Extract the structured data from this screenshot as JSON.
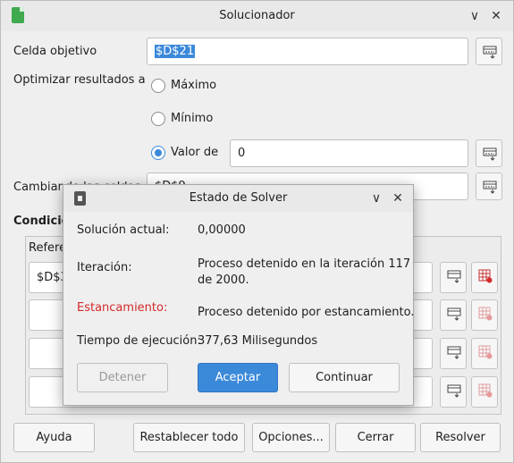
{
  "main_window": {
    "title": "Solucionador",
    "controls": {
      "minimize": "∨",
      "close": "✕"
    },
    "target_cell": {
      "label": "Celda objetivo",
      "value": "$D$21"
    },
    "optimize": {
      "label": "Optimizar resultados a",
      "options": [
        "Máximo",
        "Mínimo",
        "Valor de"
      ],
      "selected": "Valor de",
      "value_of": "0"
    },
    "changing_cells": {
      "label": "Cambiando las celdas",
      "value": "$D$9"
    },
    "conditions": {
      "label": "Condiciones",
      "ref_header": "Referencia de celda",
      "rows": [
        {
          "ref": "$D$3"
        },
        {
          "ref": ""
        },
        {
          "ref": ""
        },
        {
          "ref": ""
        }
      ]
    },
    "buttons": {
      "help": "Ayuda",
      "reset_all": "Restablecer todo",
      "options": "Opciones...",
      "close": "Cerrar",
      "solve": "Resolver"
    }
  },
  "status_dialog": {
    "title": "Estado de Solver",
    "controls": {
      "minimize": "∨",
      "close": "✕"
    },
    "current_solution": {
      "label": "Solución actual:",
      "value": "0,00000"
    },
    "iteration": {
      "label": "Iteración:",
      "line1": "Proceso detenido en la iteración 117",
      "line2": "de 2000."
    },
    "stagnation": {
      "label": "Estancamiento:",
      "value": "Proceso detenido por estancamiento.",
      "label_color": "#d42a2a"
    },
    "run_time": {
      "label": "Tiempo de ejecución:",
      "value": "377,63 Milisegundos"
    },
    "buttons": {
      "stop": "Detener",
      "accept": "Aceptar",
      "continue": "Continuar"
    }
  },
  "colors": {
    "accent": "#3b89d9",
    "app_icon": "#3faa4e"
  }
}
